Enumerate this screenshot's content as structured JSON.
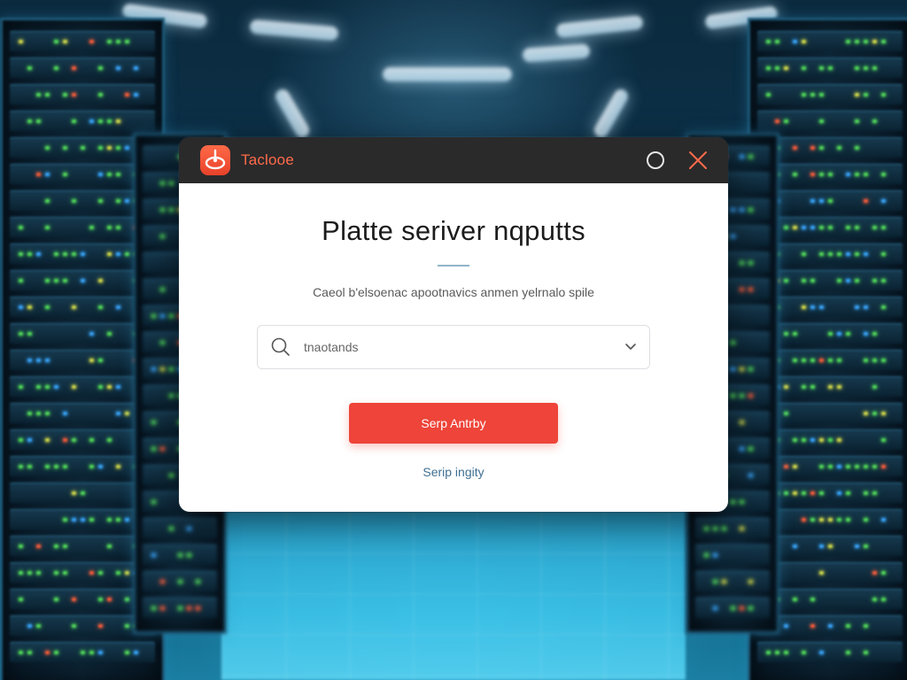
{
  "app": {
    "title": "Taclooe",
    "accent_color": "#ff6b4a",
    "icon": "app-logo-icon"
  },
  "window_controls": {
    "secondary_icon": "circle-icon",
    "close_icon": "close-icon"
  },
  "dialog": {
    "heading": "Platte seriver nqputts",
    "subtitle": "Caeol b'elsoenac apootnavics anmen yelrnalo spile",
    "select": {
      "icon": "search-icon",
      "value": "tnaotands",
      "chevron": "chevron-down-icon"
    },
    "primary_button": {
      "label": "Serp Antrby",
      "color": "#ee4439"
    },
    "link": "Serip ingity"
  }
}
